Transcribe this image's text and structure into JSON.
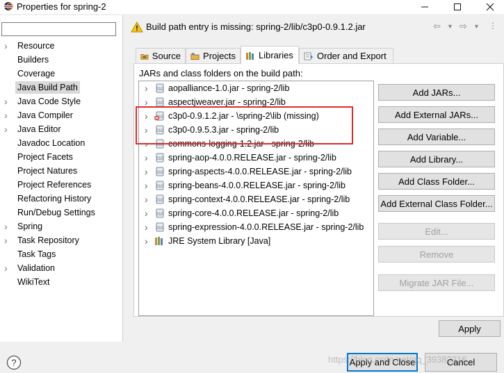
{
  "window": {
    "title": "Properties for spring-2",
    "buttons": [
      "minimize-icon",
      "maximize-icon",
      "close-icon"
    ]
  },
  "filter": {
    "value": "",
    "placeholder": ""
  },
  "nav": {
    "items": [
      {
        "label": "Resource",
        "expandable": true
      },
      {
        "label": "Builders",
        "expandable": false
      },
      {
        "label": "Coverage",
        "expandable": false
      },
      {
        "label": "Java Build Path",
        "expandable": false,
        "selected": true
      },
      {
        "label": "Java Code Style",
        "expandable": true
      },
      {
        "label": "Java Compiler",
        "expandable": true
      },
      {
        "label": "Java Editor",
        "expandable": true
      },
      {
        "label": "Javadoc Location",
        "expandable": false
      },
      {
        "label": "Project Facets",
        "expandable": false
      },
      {
        "label": "Project Natures",
        "expandable": false
      },
      {
        "label": "Project References",
        "expandable": false
      },
      {
        "label": "Refactoring History",
        "expandable": false
      },
      {
        "label": "Run/Debug Settings",
        "expandable": false
      },
      {
        "label": "Spring",
        "expandable": true
      },
      {
        "label": "Task Repository",
        "expandable": true
      },
      {
        "label": "Task Tags",
        "expandable": false
      },
      {
        "label": "Validation",
        "expandable": true
      },
      {
        "label": "WikiText",
        "expandable": false
      }
    ]
  },
  "message": {
    "text": "Build path entry is missing: spring-2/lib/c3p0-0.9.1.2.jar",
    "icon": "warning-icon"
  },
  "tabs": [
    {
      "label": "Source",
      "icon": "source-folder-icon"
    },
    {
      "label": "Projects",
      "icon": "projects-icon"
    },
    {
      "label": "Libraries",
      "icon": "libraries-icon",
      "active": true
    },
    {
      "label": "Order and Export",
      "icon": "order-export-icon"
    }
  ],
  "libraries": {
    "heading": "JARs and class folders on the build path:",
    "entries": [
      {
        "text": "aopalliance-1.0.jar - spring-2/lib",
        "expandable": true,
        "missing": false
      },
      {
        "text": "aspectjweaver.jar - spring-2/lib",
        "expandable": true,
        "missing": false
      },
      {
        "text": "c3p0-0.9.1.2.jar - \\spring-2\\lib (missing)",
        "expandable": true,
        "missing": true
      },
      {
        "text": "c3p0-0.9.5.3.jar - spring-2/lib",
        "expandable": true,
        "missing": false
      },
      {
        "text": "commons-logging-1.2.jar - spring-2/lib",
        "expandable": true,
        "missing": false
      },
      {
        "text": "spring-aop-4.0.0.RELEASE.jar - spring-2/lib",
        "expandable": true,
        "missing": false
      },
      {
        "text": "spring-aspects-4.0.0.RELEASE.jar - spring-2/lib",
        "expandable": true,
        "missing": false
      },
      {
        "text": "spring-beans-4.0.0.RELEASE.jar - spring-2/lib",
        "expandable": true,
        "missing": false
      },
      {
        "text": "spring-context-4.0.0.RELEASE.jar - spring-2/lib",
        "expandable": true,
        "missing": false
      },
      {
        "text": "spring-core-4.0.0.RELEASE.jar - spring-2/lib",
        "expandable": true,
        "missing": false
      },
      {
        "text": "spring-expression-4.0.0.RELEASE.jar - spring-2/lib",
        "expandable": true,
        "missing": false
      },
      {
        "text": "JRE System Library [Java]",
        "expandable": true,
        "missing": false,
        "library": true
      }
    ],
    "buttons": [
      {
        "label": "Add JARs...",
        "enabled": true
      },
      {
        "label": "Add External JARs...",
        "enabled": true
      },
      {
        "label": "Add Variable...",
        "enabled": true
      },
      {
        "label": "Add Library...",
        "enabled": true
      },
      {
        "label": "Add Class Folder...",
        "enabled": true
      },
      {
        "label": "Add External Class Folder...",
        "enabled": true
      },
      {
        "label": "Edit...",
        "enabled": false
      },
      {
        "label": "Remove",
        "enabled": false
      },
      {
        "label": "Migrate JAR File...",
        "enabled": false
      }
    ]
  },
  "footer": {
    "apply": "Apply",
    "apply_close": "Apply and Close",
    "cancel": "Cancel",
    "watermark": "https://blog.csdn.net/qq_39383316"
  },
  "colors": {
    "highlight": "#e02a2a",
    "default_button_border": "#0078d7"
  }
}
